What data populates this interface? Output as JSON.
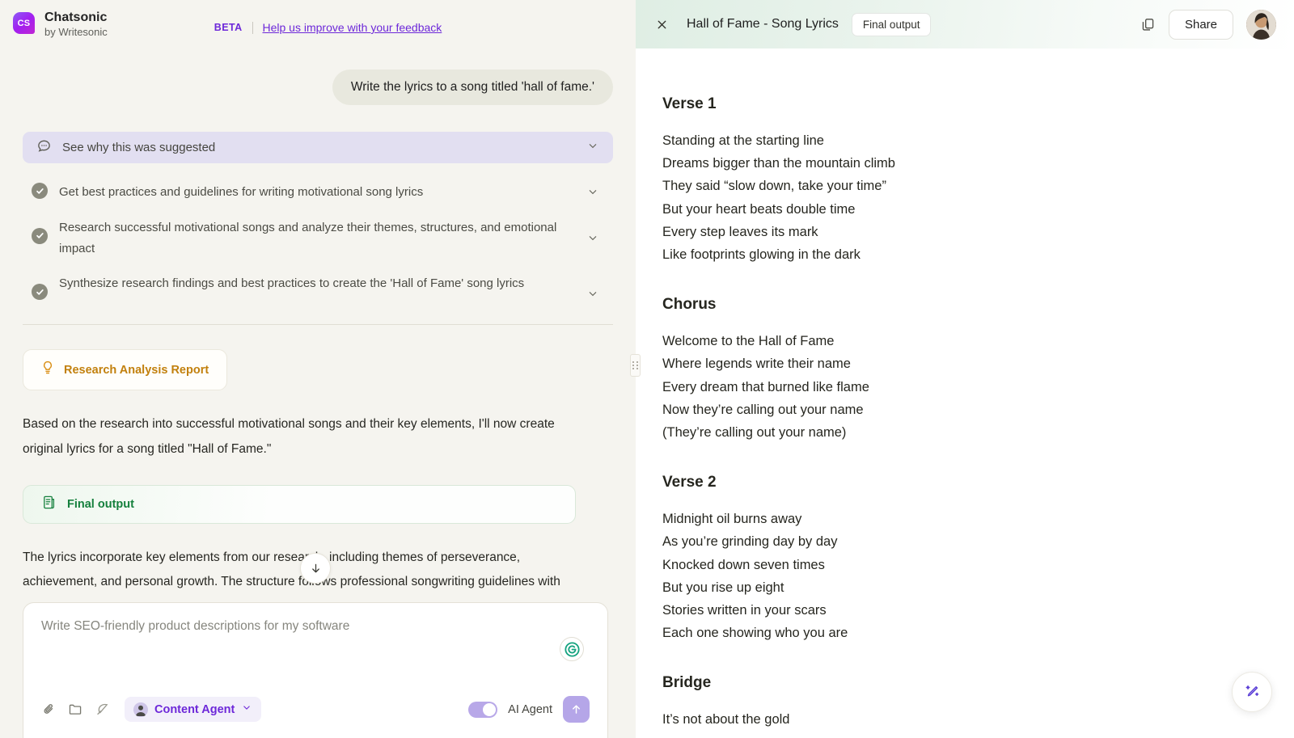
{
  "brand": {
    "logo_text": "CS",
    "name": "Chatsonic",
    "subtitle": "by Writesonic",
    "beta_tag": "BETA",
    "feedback_link": "Help us improve with your feedback"
  },
  "colors": {
    "accent_purple": "#6d28d9",
    "left_bg": "#f5f4ef",
    "suggest_bg": "#e2dff1",
    "report_orange": "#c2800d",
    "final_green": "#15803d",
    "toggle_on": "#b8a8e8"
  },
  "chat": {
    "user_message": "Write the lyrics to a song titled 'hall of fame.'",
    "suggest_bar": {
      "label": "See why this was suggested",
      "icon": "chat-bubble-icon",
      "chevron": "chevron-down-icon"
    },
    "tasks": [
      {
        "label": "Get best practices and guidelines for writing motivational song lyrics",
        "status": "complete"
      },
      {
        "label": "Research successful motivational songs and analyze their themes, structures, and emotional impact",
        "status": "complete"
      },
      {
        "label": "Synthesize research findings and best practices to create the 'Hall of Fame' song lyrics",
        "status": "complete"
      }
    ],
    "report_chip": {
      "label": "Research Analysis Report",
      "icon": "lightbulb-icon"
    },
    "paragraph": "Based on the research into successful motivational songs and their key elements, I'll now create original lyrics for a song titled \"Hall of Fame.\"",
    "final_output_card": {
      "label": "Final output",
      "icon": "document-scroll-icon"
    },
    "truncated_paragraph": "The lyrics incorporate key elements from our research, including themes of perseverance, achievement, and personal growth. The structure follows professional songwriting guidelines with clear verses, a memorable chorus, and a"
  },
  "composer": {
    "placeholder": "Write SEO-friendly product descriptions for my software",
    "value": "",
    "tools": [
      {
        "name": "attach-file-icon",
        "label": "Attach file"
      },
      {
        "name": "folder-icon",
        "label": "Browse folder"
      },
      {
        "name": "feather-icon",
        "label": "Write with AI"
      }
    ],
    "agent_chip": {
      "label": "Content Agent",
      "chevron": "chevron-down-icon"
    },
    "ai_agent_toggle": {
      "label": "AI Agent",
      "state": "on"
    },
    "send_icon": "arrow-up-icon",
    "grammarly_icon": "grammarly-icon"
  },
  "document": {
    "title": "Hall of Fame - Song Lyrics",
    "badge": "Final output",
    "close_icon": "close-icon",
    "copy_icon": "copy-icon",
    "share_label": "Share",
    "sections": [
      {
        "heading": "Verse 1",
        "lines": [
          "Standing at the starting line",
          "Dreams bigger than the mountain climb",
          "They said “slow down, take your time”",
          "But your heart beats double time",
          "Every step leaves its mark",
          "Like footprints glowing in the dark"
        ]
      },
      {
        "heading": "Chorus",
        "lines": [
          "Welcome to the Hall of Fame",
          "Where legends write their name",
          "Every dream that burned like flame",
          "Now they’re calling out your name",
          "(They’re calling out your name)"
        ]
      },
      {
        "heading": "Verse 2",
        "lines": [
          "Midnight oil burns away",
          "As you’re grinding day by day",
          "Knocked down seven times",
          "But you rise up eight",
          "Stories written in your scars",
          "Each one showing who you are"
        ]
      },
      {
        "heading": "Bridge",
        "lines": [
          "It’s not about the gold"
        ]
      }
    ],
    "fab_icon": "magic-wand-icon"
  }
}
